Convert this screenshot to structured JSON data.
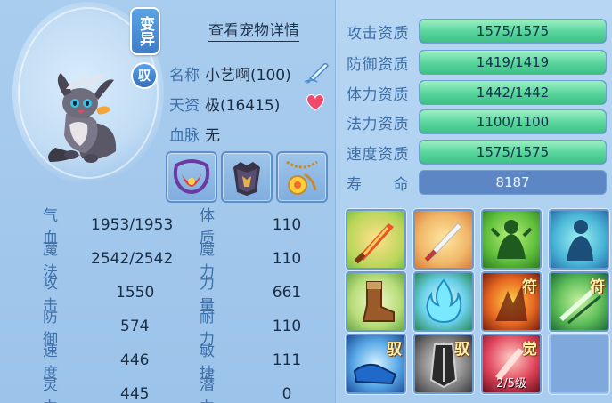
{
  "header": {
    "badge_label": "变异",
    "badge_yu": "驭",
    "detail_link": "查看宠物详情"
  },
  "info": {
    "name_label": "名称",
    "name_value": "小艺啊(100)",
    "aptitude_label": "天资",
    "aptitude_value": "极(16415)",
    "bloodline_label": "血脉",
    "bloodline_value": "无"
  },
  "equipment": [
    {
      "name": "necklace-red"
    },
    {
      "name": "armor-dark"
    },
    {
      "name": "pendant-gold"
    }
  ],
  "stats": [
    {
      "k": "气血",
      "v": "1953/1953",
      "k2": "体质",
      "v2": "110"
    },
    {
      "k": "魔法",
      "v": "2542/2542",
      "k2": "魔力",
      "v2": "110"
    },
    {
      "k": "攻击",
      "v": "1550",
      "k2": "力量",
      "v2": "661"
    },
    {
      "k": "防御",
      "v": "574",
      "k2": "耐力",
      "v2": "110"
    },
    {
      "k": "速度",
      "v": "446",
      "k2": "敏捷",
      "v2": "111"
    },
    {
      "k": "灵力",
      "v": "445",
      "k2": "潜力",
      "v2": "0"
    }
  ],
  "aptitudes": [
    {
      "label": "攻击资质",
      "value": "1575/1575",
      "fill": 1.0
    },
    {
      "label": "防御资质",
      "value": "1419/1419",
      "fill": 1.0
    },
    {
      "label": "体力资质",
      "value": "1442/1442",
      "fill": 1.0
    },
    {
      "label": "法力资质",
      "value": "1100/1100",
      "fill": 1.0
    },
    {
      "label": "速度资质",
      "value": "1575/1575",
      "fill": 1.0
    }
  ],
  "life": {
    "label": "寿　　命",
    "value": "8187"
  },
  "skills": [
    {
      "name": "skill-flame-sword",
      "tag": "",
      "level": ""
    },
    {
      "name": "skill-white-sword",
      "tag": "",
      "level": ""
    },
    {
      "name": "skill-green-warrior",
      "tag": "",
      "level": ""
    },
    {
      "name": "skill-blue-spirit",
      "tag": "",
      "level": ""
    },
    {
      "name": "skill-boot",
      "tag": "",
      "level": ""
    },
    {
      "name": "skill-blue-flame",
      "tag": "",
      "level": ""
    },
    {
      "name": "skill-fire-burst",
      "tag": "符",
      "level": ""
    },
    {
      "name": "skill-green-slash",
      "tag": "符",
      "level": ""
    },
    {
      "name": "skill-blue-shoe",
      "tag": "驭",
      "level": ""
    },
    {
      "name": "skill-dark-blade",
      "tag": "驭",
      "level": ""
    },
    {
      "name": "skill-red-awaken",
      "tag": "觉",
      "level": "2/5级"
    },
    {
      "name": "skill-empty-slot",
      "tag": "",
      "level": ""
    }
  ],
  "colors": {
    "label_blue": "#3e6fa8",
    "value_dark": "#1a2e46",
    "bar_green": "#56d49b",
    "bar_track": "#4a79b8"
  }
}
